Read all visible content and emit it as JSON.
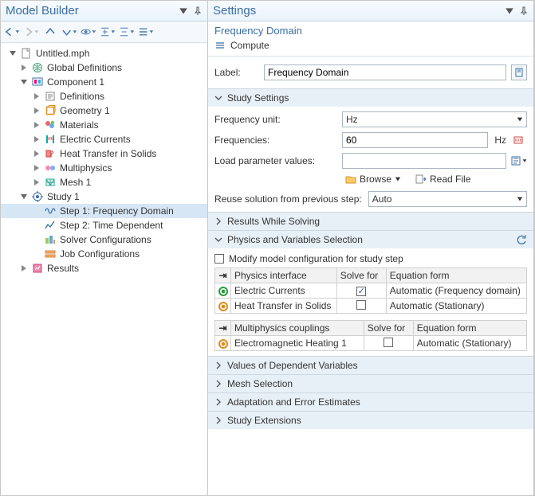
{
  "model_builder": {
    "title": "Model Builder",
    "toolbar": {
      "back": "←",
      "fwd": "→",
      "up": "↑",
      "down": "↓"
    },
    "tree": {
      "root": "Untitled.mph",
      "global_defs": "Global Definitions",
      "component": "Component 1",
      "definitions": "Definitions",
      "geometry": "Geometry 1",
      "materials": "Materials",
      "electric_currents": "Electric Currents",
      "heat_transfer": "Heat Transfer in Solids",
      "multiphysics": "Multiphysics",
      "mesh": "Mesh 1",
      "study": "Study 1",
      "step1": "Step 1: Frequency Domain",
      "step2": "Step 2: Time Dependent",
      "solver_cfg": "Solver Configurations",
      "job_cfg": "Job Configurations",
      "results": "Results"
    }
  },
  "settings": {
    "title": "Settings",
    "subtitle": "Frequency Domain",
    "compute": "Compute",
    "label_caption": "Label:",
    "label_value": "Frequency Domain",
    "sections": {
      "study_settings": "Study Settings",
      "results_while_solving": "Results While Solving",
      "physics_vars": "Physics and Variables Selection",
      "dep_vars": "Values of Dependent Variables",
      "mesh_sel": "Mesh Selection",
      "adapt": "Adaptation and Error Estimates",
      "study_ext": "Study Extensions"
    },
    "study": {
      "freq_unit_label": "Frequency unit:",
      "freq_unit_value": "Hz",
      "freqs_label": "Frequencies:",
      "freqs_value": "60",
      "freqs_unit": "Hz",
      "load_params_label": "Load parameter values:",
      "load_params_value": "",
      "browse": "Browse",
      "read_file": "Read File",
      "reuse_label": "Reuse solution from previous step:",
      "reuse_value": "Auto"
    },
    "physics": {
      "modify_label": "Modify model configuration for study step",
      "headers": {
        "interface": "Physics interface",
        "solve_for": "Solve for",
        "eq_form": "Equation form",
        "couplings": "Multiphysics couplings"
      },
      "rows": [
        {
          "name": "Electric Currents",
          "solve": true,
          "eq": "Automatic (Frequency domain)",
          "status": "green"
        },
        {
          "name": "Heat Transfer in Solids",
          "solve": false,
          "eq": "Automatic (Stationary)",
          "status": "orange"
        }
      ],
      "mp_rows": [
        {
          "name": "Electromagnetic Heating 1",
          "solve": false,
          "eq": "Automatic (Stationary)",
          "status": "orange"
        }
      ]
    }
  }
}
